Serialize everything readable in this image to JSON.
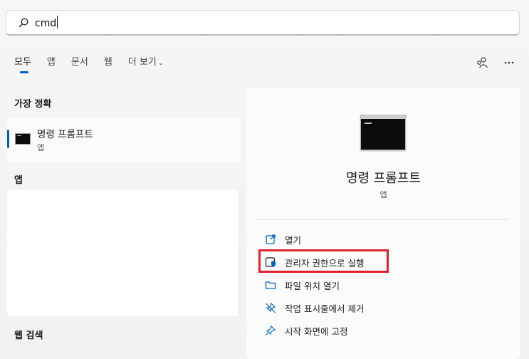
{
  "search": {
    "value": "cmd"
  },
  "tabs": [
    {
      "label": "모두",
      "active": true
    },
    {
      "label": "앱"
    },
    {
      "label": "문서"
    },
    {
      "label": "웹"
    },
    {
      "label": "더 보기"
    }
  ],
  "left": {
    "best_match_title": "가장 정확",
    "best_match": {
      "title": "명령 프롬프트",
      "subtitle": "앱"
    },
    "apps_title": "앱",
    "web_title": "웹 검색"
  },
  "right": {
    "title": "명령 프롬프트",
    "subtitle": "앱",
    "actions": [
      {
        "label": "열기",
        "icon": "open-icon"
      },
      {
        "label": "관리자 권한으로 실행",
        "icon": "admin-shield-icon"
      },
      {
        "label": "파일 위치 열기",
        "icon": "folder-icon"
      },
      {
        "label": "작업 표시줄에서 제거",
        "icon": "unpin-icon"
      },
      {
        "label": "시작 화면에 고정",
        "icon": "pin-icon"
      }
    ]
  },
  "colors": {
    "accent": "#005fb8",
    "highlight": "#e0202a"
  }
}
